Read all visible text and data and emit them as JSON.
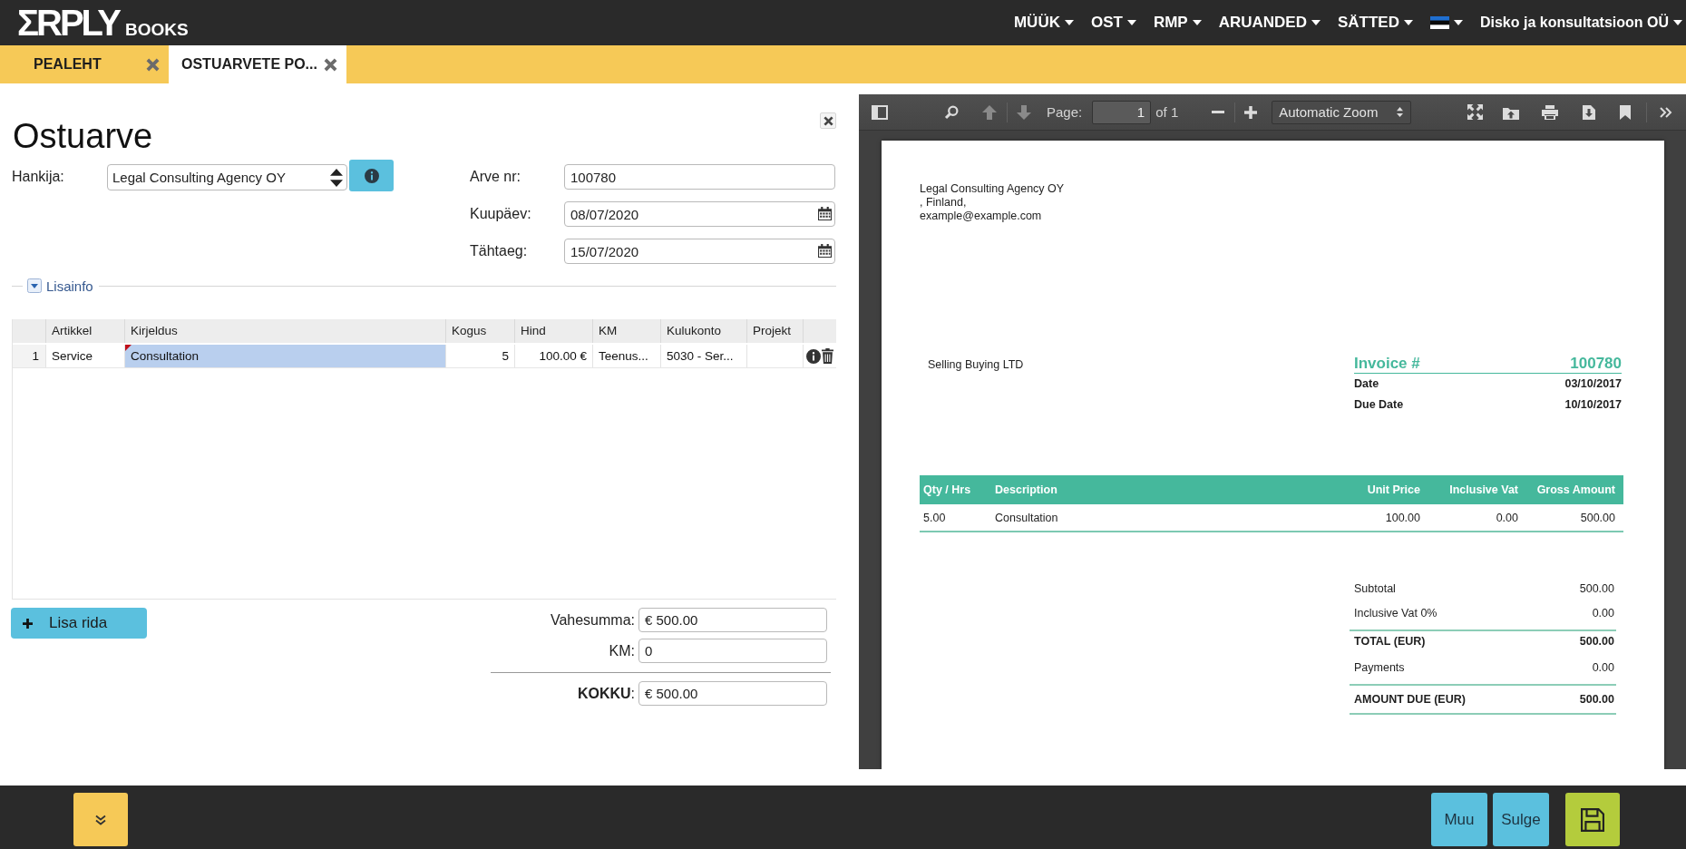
{
  "header": {
    "logo": "ΣRPLY",
    "logo_suffix": "BOOKS",
    "menu": [
      "MÜÜK",
      "OST",
      "RMP",
      "ARUANDED",
      "SÄTTED"
    ],
    "company": "Disko ja konsultatsioon OÜ"
  },
  "tabs": [
    {
      "label": "PEALEHT",
      "selected": false
    },
    {
      "label": "OSTUARVETE PO...",
      "selected": true
    }
  ],
  "invoice_form": {
    "title": "Ostuarve",
    "supplier": {
      "label": "Hankija:",
      "value": "Legal Consulting Agency OY"
    },
    "fields": [
      {
        "kind": "text",
        "label": "Arve nr:",
        "value": "100780"
      },
      {
        "kind": "date",
        "label": "Kuupäev:",
        "value": "08/07/2020"
      },
      {
        "kind": "date",
        "label": "Tähtaeg:",
        "value": "15/07/2020"
      }
    ],
    "extra_info": {
      "label": "Lisainfo",
      "expanded": false
    },
    "lines": {
      "columns": [
        {
          "label": "Artikkel",
          "kind": "text"
        },
        {
          "label": "Kirjeldus",
          "kind": "text"
        },
        {
          "label": "Kogus",
          "kind": "number"
        },
        {
          "label": "Hind",
          "kind": "number"
        },
        {
          "label": "KM",
          "kind": "text"
        },
        {
          "label": "Kulukonto",
          "kind": "text"
        },
        {
          "label": "Projekt",
          "kind": "text"
        }
      ],
      "rows": [
        {
          "number": "1",
          "cells": [
            {
              "text": "Service",
              "selected": false,
              "comment": false
            },
            {
              "text": "Consultation",
              "selected": true,
              "comment": true
            },
            {
              "text": "5",
              "selected": false,
              "comment": false
            },
            {
              "text": "100.00 €",
              "selected": false,
              "comment": false
            },
            {
              "text": "Teenus...",
              "selected": false,
              "comment": false
            },
            {
              "text": "5030 - Ser...",
              "selected": false,
              "comment": false
            },
            {
              "selected": false,
              "comment": false
            }
          ]
        }
      ]
    },
    "add_row": "Lisa rida",
    "totals": [
      {
        "kind": "sum",
        "label": "Vahesumma:",
        "value": "€ 500.00"
      },
      {
        "kind": "sum",
        "label": "KM:",
        "value": "0"
      },
      {
        "kind": "total",
        "label": "**KOKKU**:",
        "value": "€ 500.00"
      }
    ]
  },
  "pdf_viewer": {
    "toolbar": {
      "nav": [
        {
          "kind": "previous",
          "disabled": true
        },
        {
          "kind": "next",
          "disabled": true
        }
      ],
      "page_label": "Page:",
      "page": "1",
      "page_count": "of 1",
      "zoom": "Automatic Zoom"
    },
    "document": {
      "sender_lines": [
        "Legal Consulting Agency OY",
        ", Finland,",
        "example@example.com"
      ],
      "recipient": "Selling Buying LTD",
      "invoice": {
        "label": "Invoice #",
        "number": "100780",
        "details": [
          {
            "label": "Date",
            "value": "03/10/2017"
          },
          {
            "label": "Due Date",
            "value": "10/10/2017"
          }
        ]
      },
      "items": {
        "columns": [
          {
            "label": "Qty / Hrs",
            "kind": "text"
          },
          {
            "label": "Description",
            "kind": "text"
          },
          {
            "label": "Unit Price",
            "kind": "number"
          },
          {
            "label": "Inclusive Vat",
            "kind": "number"
          },
          {
            "label": "Gross Amount",
            "kind": "number"
          }
        ],
        "rows": [
          [
            "5.00",
            "Consultation",
            "100.00",
            "0.00",
            "500.00"
          ]
        ]
      },
      "totals": [
        {
          "kind": "normal",
          "label": "Subtotal",
          "value": "500.00"
        },
        {
          "kind": "normal",
          "label": "Inclusive Vat 0%",
          "value": "0.00"
        },
        {
          "kind": "total",
          "label": "TOTAL (EUR)",
          "value": "500.00"
        },
        {
          "kind": "normal",
          "label": "Payments",
          "value": "0.00"
        },
        {
          "kind": "total",
          "label": "AMOUNT DUE (EUR)",
          "value": "500.00"
        }
      ]
    }
  },
  "footer": {
    "buttons": [
      {
        "kind": "text",
        "label": "Muu"
      },
      {
        "kind": "text",
        "label": "Sulge"
      },
      {
        "kind": "save"
      }
    ]
  }
}
